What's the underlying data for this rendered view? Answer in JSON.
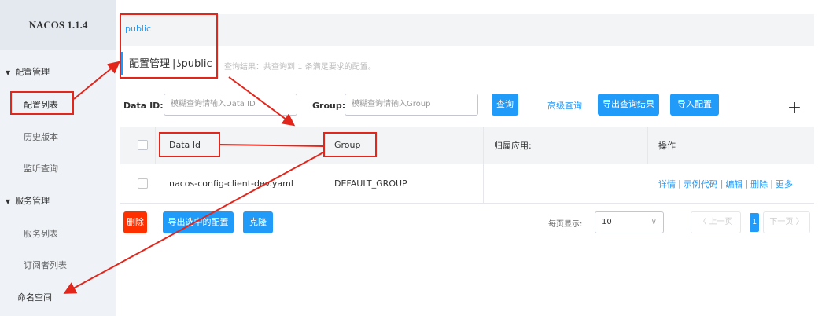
{
  "brand": {
    "title": "NACOS 1.1.4"
  },
  "sidebar": {
    "group_config": "配置管理",
    "items_config": [
      "配置列表",
      "历史版本",
      "监听查询"
    ],
    "group_service": "服务管理",
    "items_service": [
      "服务列表",
      "订阅者列表"
    ],
    "namespace": "命名空间"
  },
  "namespace_bar": {
    "active": "public"
  },
  "breadcrumb": {
    "title": "配置管理",
    "separator": "|",
    "namespace": "public",
    "cursor_prefix": "ʖ"
  },
  "result_summary": "查询结果：共查询到 1 条满足要求的配置。",
  "search": {
    "data_id_label": "Data ID:",
    "data_id_placeholder": "模糊查询请输入Data ID",
    "group_label": "Group:",
    "group_placeholder": "模糊查询请输入Group",
    "query_button": "查询",
    "advanced_link": "高级查询",
    "export_results_button": "导出查询结果",
    "import_button": "导入配置",
    "add_button": "+"
  },
  "table": {
    "columns": [
      "Data Id",
      "Group",
      "归属应用:",
      "操作"
    ],
    "rows": [
      {
        "data_id": "nacos-config-client-dev.yaml",
        "group": "DEFAULT_GROUP",
        "app": "",
        "actions": [
          "详情",
          "示例代码",
          "编辑",
          "删除",
          "更多"
        ]
      }
    ],
    "actions_separator": "|"
  },
  "bottom": {
    "delete_button": "删除",
    "export_selected_button": "导出选中的配置",
    "clone_button": "克隆",
    "page_size_label": "每页显示:",
    "page_size_value": "10",
    "page_size_arrow": "∨",
    "prev_label": "〈 上一页",
    "current_page": "1",
    "next_label": "下一页 〉"
  },
  "colors": {
    "accent": "#209bfa",
    "danger": "#ff3000",
    "annotation": "#e3261c",
    "sidebar_bg": "#eff3f8"
  }
}
